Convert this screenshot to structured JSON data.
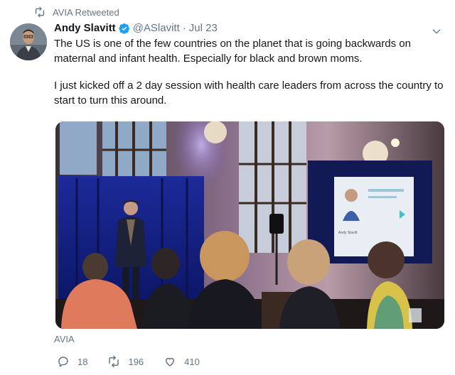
{
  "retweet": {
    "text": "AVIA Retweeted"
  },
  "author": {
    "display_name": "Andy Slavitt",
    "handle": "@ASlavitt",
    "separator": "·",
    "date": "Jul 23"
  },
  "tweet": {
    "paragraphs": [
      "The US is one of the few countries on the planet that is going backwards on maternal and infant health. Especially for black and brown moms.",
      "I just kicked off a 2 day session with health care leaders from across the country to start to turn this around."
    ]
  },
  "media": {
    "slide_caption": "Andy Slavitt"
  },
  "source": "AVIA",
  "actions": {
    "replies": "18",
    "retweets": "196",
    "likes": "410"
  },
  "colors": {
    "verified": "#1da1f2",
    "muted": "#657786",
    "text": "#14171a"
  },
  "icons": [
    "retweet-icon",
    "verified-badge-icon",
    "chevron-down-icon",
    "reply-icon",
    "like-icon"
  ]
}
